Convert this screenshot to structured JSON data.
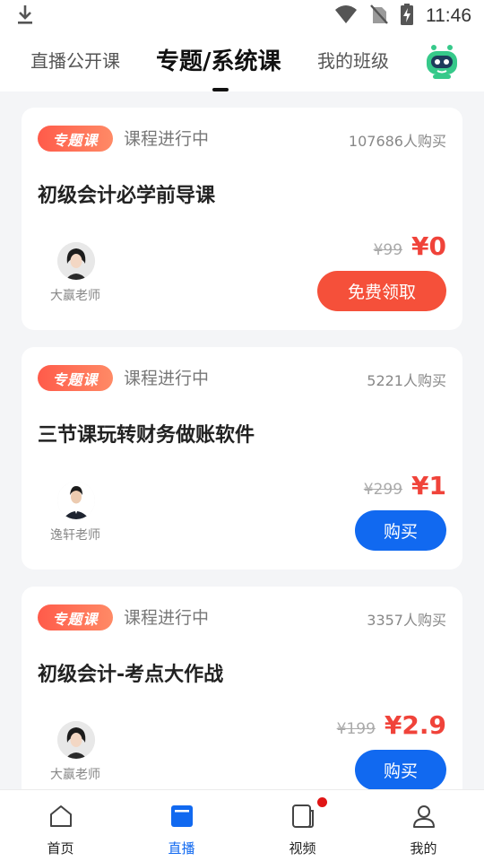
{
  "status_bar": {
    "time": "11:46",
    "icons": [
      "download-icon",
      "wifi-icon",
      "no-sim-icon",
      "battery-charging-icon"
    ]
  },
  "tabs": [
    {
      "label": "直播公开课",
      "active": false
    },
    {
      "label": "专题/系统课",
      "active": true
    },
    {
      "label": "我的班级",
      "active": false
    }
  ],
  "courses": [
    {
      "badge": "专题课",
      "status": "课程进行中",
      "buyers": "107686人购买",
      "title": "初级会计必学前导课",
      "teacher": "大赢老师",
      "original_price": "¥99",
      "price": "¥0",
      "action": "免费领取"
    },
    {
      "badge": "专题课",
      "status": "课程进行中",
      "buyers": "5221人购买",
      "title": "三节课玩转财务做账软件",
      "teacher": "逸轩老师",
      "original_price": "¥299",
      "price": "¥1",
      "action": "购买"
    },
    {
      "badge": "专题课",
      "status": "课程进行中",
      "buyers": "3357人购买",
      "title": "初级会计-考点大作战",
      "teacher": "大赢老师",
      "original_price": "¥199",
      "price": "¥2.9",
      "action": "购买"
    }
  ],
  "bottom_nav": [
    {
      "label": "首页",
      "icon": "home-icon",
      "active": false
    },
    {
      "label": "直播",
      "icon": "live-icon",
      "active": true
    },
    {
      "label": "视频",
      "icon": "video-icon",
      "active": false,
      "has_dot": true
    },
    {
      "label": "我的",
      "icon": "profile-icon",
      "active": false
    }
  ],
  "colors": {
    "accent_blue": "#1169f0",
    "price_red": "#f0433a",
    "badge_orange": "#ff5b4a"
  }
}
